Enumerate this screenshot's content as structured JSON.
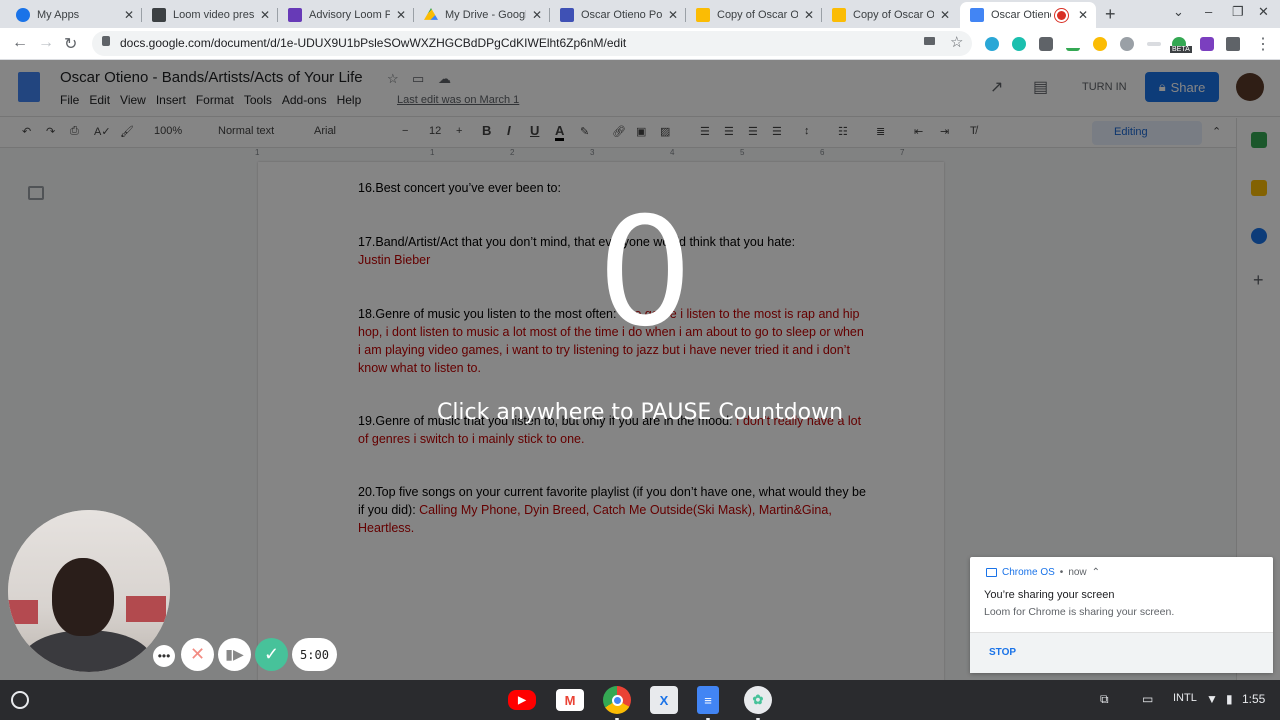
{
  "browser": {
    "tabs": [
      {
        "title": "My Apps",
        "favicon_color": "#1a73e8"
      },
      {
        "title": "Loom video prese",
        "favicon_color": "#3c4043"
      },
      {
        "title": "Advisory Loom P",
        "favicon_color": "#673ab7"
      },
      {
        "title": "My Drive - Google",
        "favicon_color": "#fbbc04"
      },
      {
        "title": "Oscar Otieno Port",
        "favicon_color": "#3f51b5"
      },
      {
        "title": "Copy of Oscar Oti",
        "favicon_color": "#fbbc04"
      },
      {
        "title": "Copy of Oscar Oti",
        "favicon_color": "#fbbc04"
      },
      {
        "title": "Oscar Otieno",
        "favicon_color": "#4285f4"
      }
    ],
    "url": "docs.google.com/document/d/1e-UDUX9U1bPsleSOwWXZHGCBdDPgCdKIWElht6Zp6nM/edit",
    "extensions_beta_label": "BETA"
  },
  "docs": {
    "title": "Oscar Otieno - Bands/Artists/Acts of Your Life",
    "menu": [
      "File",
      "Edit",
      "View",
      "Insert",
      "Format",
      "Tools",
      "Add-ons",
      "Help"
    ],
    "last_edit": "Last edit was on March 1",
    "turn_in": "TURN IN",
    "share": "Share",
    "zoom": "100%",
    "style": "Normal text",
    "font": "Arial",
    "font_size": "12",
    "mode": "Editing",
    "ruler_marks": [
      "1",
      "1",
      "2",
      "3",
      "4",
      "5",
      "6",
      "7"
    ],
    "questions": [
      {
        "num": "16.",
        "text": "Best concert you’ve ever been to:",
        "answer": ""
      },
      {
        "num": "17.",
        "text": "Band/Artist/Act that you don’t mind, that everyone would think that you hate:",
        "answer": "Justin Bieber"
      },
      {
        "num": "18.",
        "text": "Genre of music you listen to the most often:",
        "answer": "The genre i listen to the most is rap and hip hop, i dont listen to music a lot most of the time i do when i am about to go to sleep or when i am playing video games, i want to try listening to jazz but i have never tried it and i don’t know what to listen to."
      },
      {
        "num": "19.",
        "text": "Genre of music that you listen to, but only if you are in the mood:",
        "answer": "I don’t really have a lot of genres i switch to i mainly stick to one."
      },
      {
        "num": "20.",
        "text": "Top five songs on your current favorite playlist (if you don’t have one, what would they be if you did):",
        "answer": "Calling My Phone, Dyin Breed, Catch Me Outside(Ski Mask), Martin&Gina, Heartless."
      }
    ]
  },
  "loom": {
    "countdown": "0",
    "pause_message": "Click anywhere to PAUSE Countdown",
    "timer": "5:00",
    "more_glyph": "•••",
    "delete_glyph": "✕",
    "pause_glyph": "▮▶",
    "done_glyph": "✓"
  },
  "notification": {
    "source": "Chrome OS",
    "time": "now",
    "heading": "You’re sharing your screen",
    "body": "Loom for Chrome is sharing your screen.",
    "action": "STOP"
  },
  "shelf": {
    "apps": [
      {
        "name": "YouTube",
        "color": "#ff0000",
        "glyph": "▶"
      },
      {
        "name": "Gmail",
        "color": "#ffffff",
        "glyph": "M"
      },
      {
        "name": "Chrome",
        "color": "#34a853",
        "glyph": "●"
      },
      {
        "name": "Xodo",
        "color": "#e8eaed",
        "glyph": "X"
      },
      {
        "name": "Docs",
        "color": "#4285f4",
        "glyph": "≡"
      },
      {
        "name": "Loom",
        "color": "#e8eaed",
        "glyph": "✿"
      }
    ],
    "keyboard": "INTL",
    "clock": "1:55"
  },
  "colors": {
    "accent": "#1a73e8",
    "answer_red": "#c00000",
    "loom_green": "#47c29a"
  }
}
